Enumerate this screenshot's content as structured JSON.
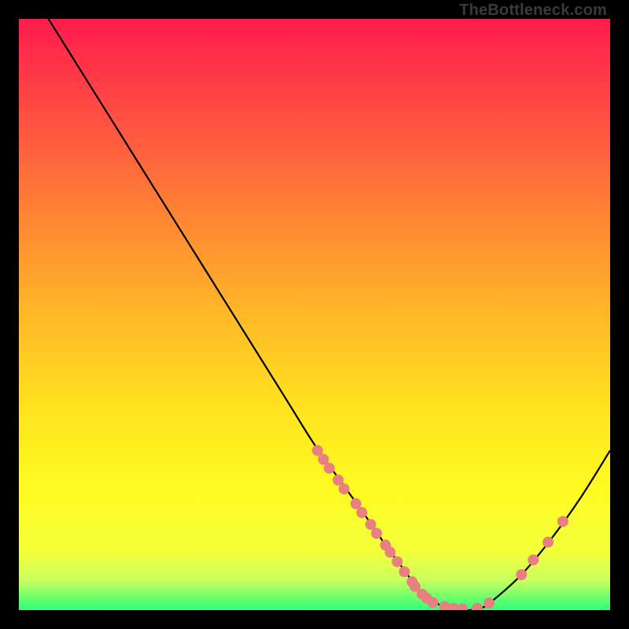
{
  "attribution": "TheBottleneck.com",
  "colors": {
    "curve": "#000000",
    "dot_fill": "#e98080",
    "dot_stroke": "#c46060"
  },
  "chart_data": {
    "type": "line",
    "title": "",
    "xlabel": "",
    "ylabel": "",
    "xlim": [
      0,
      100
    ],
    "ylim": [
      0,
      100
    ],
    "grid": false,
    "legend": false,
    "series": [
      {
        "name": "bottleneck-curve",
        "x": [
          5,
          10,
          15,
          20,
          25,
          30,
          35,
          40,
          45,
          50,
          55,
          60,
          62,
          65,
          68,
          70,
          72,
          75,
          78,
          80,
          85,
          90,
          95,
          100
        ],
        "y": [
          100,
          92,
          84,
          76,
          68,
          60,
          52,
          44,
          36,
          28,
          21,
          14,
          11,
          7,
          3,
          1.5,
          0.6,
          0,
          0.3,
          1.5,
          6,
          12,
          19,
          27
        ]
      }
    ],
    "scatter": [
      {
        "name": "highlight-dots",
        "points": [
          {
            "x": 50.5,
            "y": 27.0
          },
          {
            "x": 51.5,
            "y": 25.5
          },
          {
            "x": 52.5,
            "y": 24.0
          },
          {
            "x": 54.0,
            "y": 22.0
          },
          {
            "x": 55.0,
            "y": 20.5
          },
          {
            "x": 57.0,
            "y": 18.0
          },
          {
            "x": 58.0,
            "y": 16.5
          },
          {
            "x": 59.5,
            "y": 14.5
          },
          {
            "x": 60.5,
            "y": 13.0
          },
          {
            "x": 62.0,
            "y": 11.0
          },
          {
            "x": 62.8,
            "y": 9.8
          },
          {
            "x": 64.0,
            "y": 8.2
          },
          {
            "x": 65.2,
            "y": 6.5
          },
          {
            "x": 66.5,
            "y": 4.8
          },
          {
            "x": 67.0,
            "y": 4.0
          },
          {
            "x": 68.2,
            "y": 2.7
          },
          {
            "x": 69.0,
            "y": 2.0
          },
          {
            "x": 70.0,
            "y": 1.3
          },
          {
            "x": 72.0,
            "y": 0.6
          },
          {
            "x": 73.5,
            "y": 0.3
          },
          {
            "x": 75.0,
            "y": 0.2
          },
          {
            "x": 77.5,
            "y": 0.3
          },
          {
            "x": 79.5,
            "y": 1.2
          },
          {
            "x": 85.0,
            "y": 6.0
          },
          {
            "x": 87.0,
            "y": 8.5
          },
          {
            "x": 89.5,
            "y": 11.5
          },
          {
            "x": 92.0,
            "y": 15.0
          }
        ]
      }
    ]
  }
}
